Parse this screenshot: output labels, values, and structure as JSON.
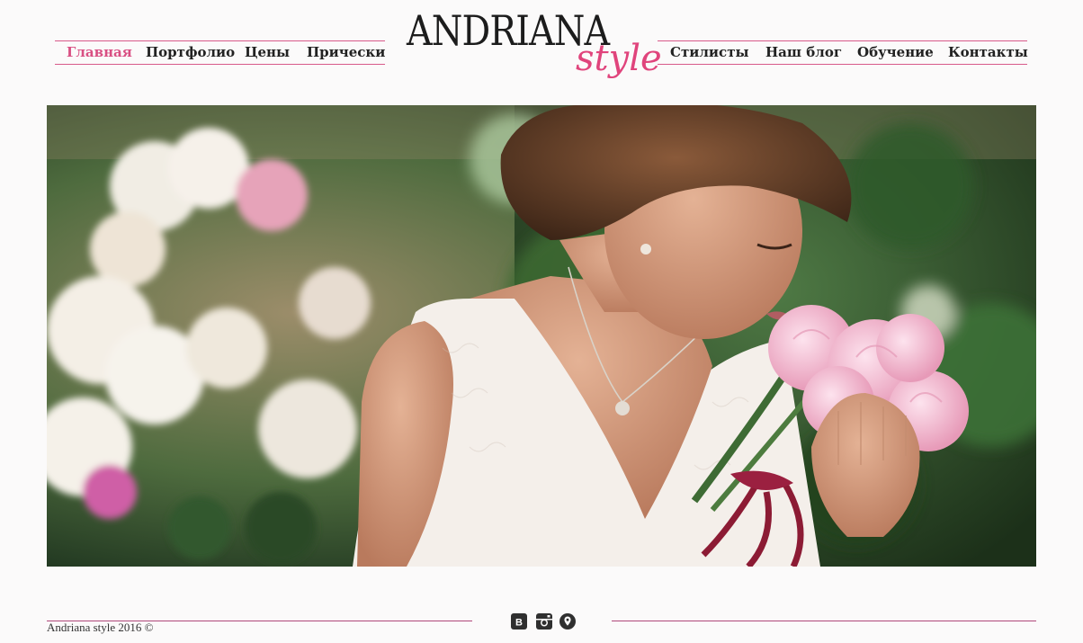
{
  "nav_left": [
    {
      "label": "Главная",
      "active": true
    },
    {
      "label": "Портфолио",
      "active": false
    },
    {
      "label": "Цены",
      "active": false
    },
    {
      "label": "Прически",
      "active": false
    }
  ],
  "nav_right": [
    {
      "label": "Стилисты",
      "active": false
    },
    {
      "label": "Наш блог",
      "active": false
    },
    {
      "label": "Обучение",
      "active": false
    },
    {
      "label": "Контакты",
      "active": false
    }
  ],
  "logo": {
    "main": "ANDRIANA",
    "sub": "style"
  },
  "footer": {
    "copyright": "Andriana style 2016 ©"
  },
  "social": [
    "vk-icon",
    "instagram-icon",
    "location-pin-icon"
  ],
  "colors": {
    "accent": "#d94f83",
    "divider": "#b0487a",
    "background": "#fbfafa"
  }
}
